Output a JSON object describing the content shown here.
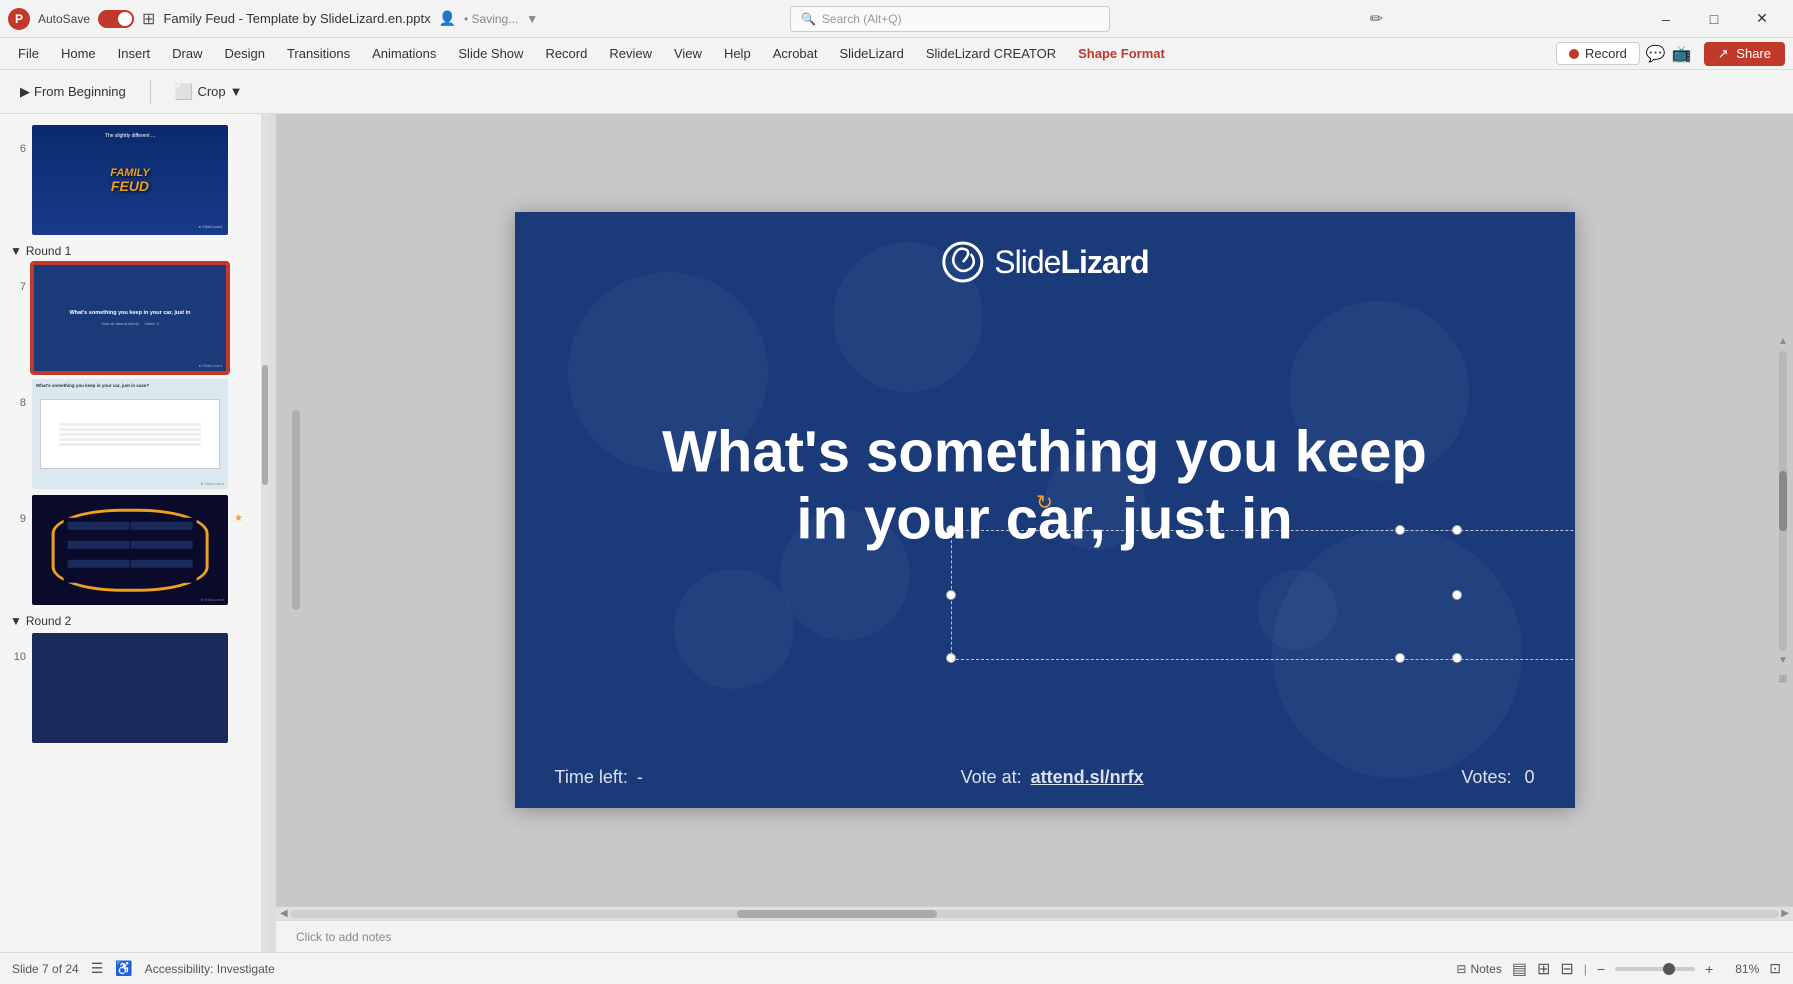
{
  "titlebar": {
    "app_name": "P",
    "autosave_label": "AutoSave",
    "file_title": "Family Feud - Template by SlideLizard.en.pptx",
    "collab_icon": "👤",
    "saving_text": "• Saving...",
    "search_placeholder": "Search (Alt+Q)",
    "designer_icon": "✏",
    "minimize": "–",
    "maximize": "□",
    "close": "✕"
  },
  "menubar": {
    "items": [
      {
        "label": "File",
        "active": false
      },
      {
        "label": "Home",
        "active": false
      },
      {
        "label": "Insert",
        "active": false
      },
      {
        "label": "Draw",
        "active": false
      },
      {
        "label": "Design",
        "active": false
      },
      {
        "label": "Transitions",
        "active": false
      },
      {
        "label": "Animations",
        "active": false
      },
      {
        "label": "Slide Show",
        "active": false
      },
      {
        "label": "Record",
        "active": false
      },
      {
        "label": "Review",
        "active": false
      },
      {
        "label": "View",
        "active": false
      },
      {
        "label": "Help",
        "active": false
      },
      {
        "label": "Acrobat",
        "active": false
      },
      {
        "label": "SlideLizard",
        "active": false
      },
      {
        "label": "SlideLizard CREATOR",
        "active": false
      },
      {
        "label": "Shape Format",
        "active": true
      }
    ],
    "record_btn": "Record",
    "share_btn": "Share"
  },
  "toolbar": {
    "from_beginning": "From Beginning",
    "crop": "Crop",
    "crop_arrow": "▼"
  },
  "slides": [
    {
      "number": "6",
      "type": "ff_title",
      "slightly_text": "The slightly different ...",
      "ff_text": "FAMILY FEUD"
    },
    {
      "number": "7",
      "type": "question",
      "active": true,
      "main_text": "What's something you keep in your car, just in"
    },
    {
      "number": "8",
      "type": "answers",
      "main_text": "What's something you keep in your car, just in case?"
    },
    {
      "number": "9",
      "type": "board",
      "star": "★"
    }
  ],
  "round_labels": [
    {
      "label": "Round 1",
      "collapsed": false
    },
    {
      "label": "Round 2",
      "collapsed": false
    }
  ],
  "main_slide": {
    "logo_text_light": "Slide",
    "logo_text_bold": "Lizard",
    "main_heading": "What's something you keep in your car, just in",
    "time_left_label": "Time left:",
    "time_left_value": "-",
    "vote_label": "Vote at:",
    "vote_url": "attend.sl/nrfx",
    "votes_label": "Votes:",
    "votes_value": "0"
  },
  "statusbar": {
    "slide_info": "Slide 7 of 24",
    "accessibility": "Accessibility: Investigate",
    "notes_label": "Notes",
    "zoom_value": "81%",
    "view_normal": "▤",
    "view_grid": "⊞",
    "view_presenter": "⊟"
  },
  "notes": {
    "placeholder": "Click to add notes"
  },
  "colors": {
    "accent": "#c0392b",
    "slide_bg": "#1a3a7a",
    "logo_orange": "#f0a020"
  }
}
